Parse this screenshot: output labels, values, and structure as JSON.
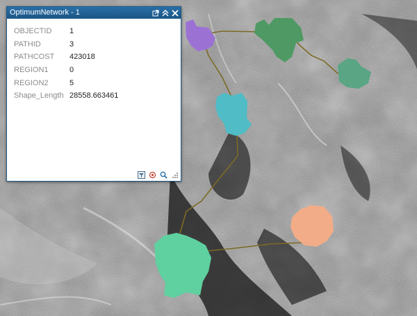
{
  "popup": {
    "title": "OptimumNetwork - 1",
    "attributes": [
      {
        "name": "OBJECTID",
        "value": "1"
      },
      {
        "name": "PATHID",
        "value": "3"
      },
      {
        "name": "PATHCOST",
        "value": "423018"
      },
      {
        "name": "REGION1",
        "value": "0"
      },
      {
        "name": "REGION2",
        "value": "5"
      },
      {
        "name": "Shape_Length",
        "value": "28558.663461"
      }
    ],
    "header_icons": [
      "popout-icon",
      "collapse-icon",
      "close-icon"
    ],
    "footer_icons": [
      "filter-icon",
      "pan-to-icon",
      "zoom-to-icon",
      "resize-grip-icon"
    ]
  },
  "map": {
    "basemap": "grayscale cost surface raster",
    "region_colors": {
      "purple": "#9b72d4",
      "dark_green": "#4f9a64",
      "teal_green": "#5aa583",
      "cyan": "#4fbcc6",
      "mint": "#5fd0a0",
      "salmon": "#f2ac88"
    },
    "path_color": "#7d6a24"
  }
}
